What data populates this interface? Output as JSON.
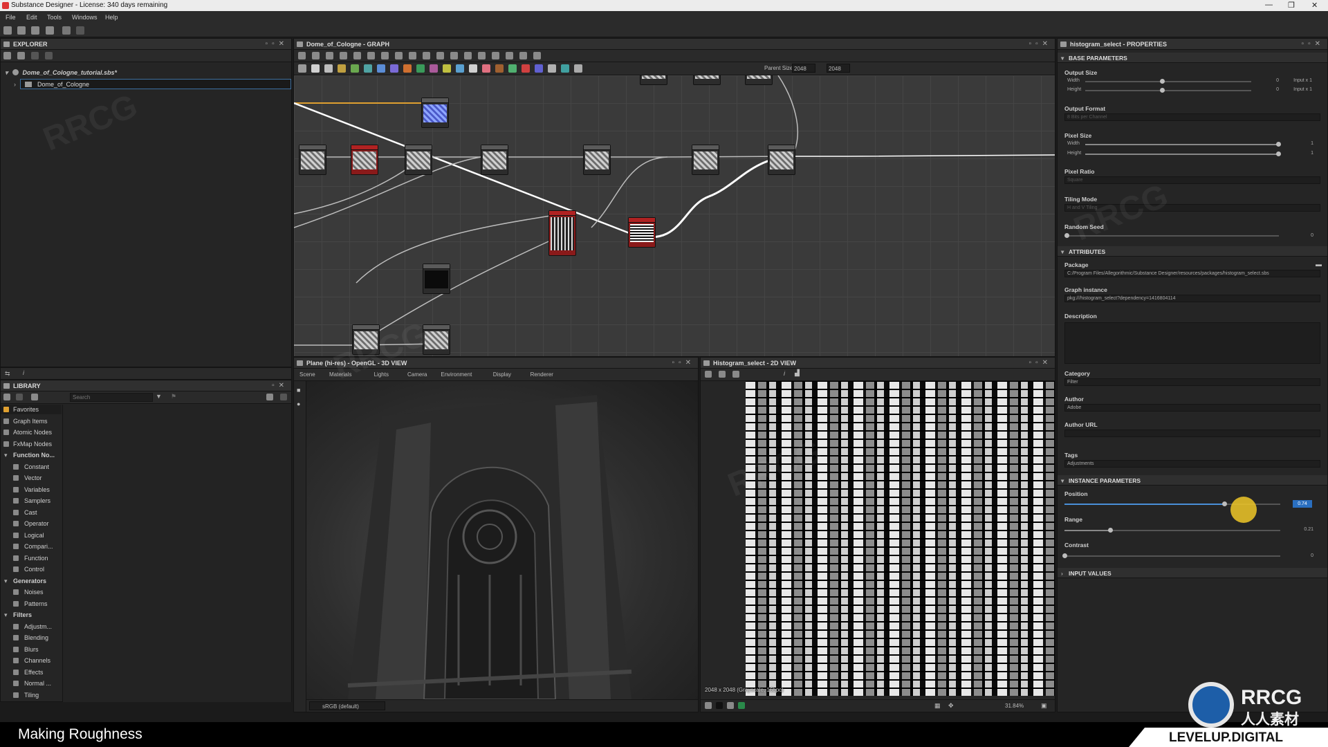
{
  "titlebar": {
    "title": "Substance Designer - License: 340 days remaining"
  },
  "menu": [
    "File",
    "Edit",
    "Tools",
    "Windows",
    "Help"
  ],
  "explorer": {
    "title": "EXPLORER",
    "package": "Dome_of_Cologne_tutorial.sbs*",
    "graph": "Dome_of_Cologne"
  },
  "graph_panel": {
    "title": "Dome_of_Cologne - GRAPH",
    "parent_size_label": "Parent Size:",
    "width_value": "2048",
    "height_value": "2048"
  },
  "library": {
    "title": "LIBRARY",
    "search_placeholder": "Search",
    "items": [
      {
        "label": "Favorites",
        "type": "item"
      },
      {
        "label": "Graph Items",
        "type": "item"
      },
      {
        "label": "Atomic Nodes",
        "type": "item"
      },
      {
        "label": "FxMap Nodes",
        "type": "item"
      },
      {
        "label": "Function No...",
        "type": "group"
      },
      {
        "label": "Constant",
        "type": "sub"
      },
      {
        "label": "Vector",
        "type": "sub"
      },
      {
        "label": "Variables",
        "type": "sub"
      },
      {
        "label": "Samplers",
        "type": "sub"
      },
      {
        "label": "Cast",
        "type": "sub"
      },
      {
        "label": "Operator",
        "type": "sub"
      },
      {
        "label": "Logical",
        "type": "sub"
      },
      {
        "label": "Compari...",
        "type": "sub"
      },
      {
        "label": "Function",
        "type": "sub"
      },
      {
        "label": "Control",
        "type": "sub"
      },
      {
        "label": "Generators",
        "type": "group"
      },
      {
        "label": "Noises",
        "type": "sub"
      },
      {
        "label": "Patterns",
        "type": "sub"
      },
      {
        "label": "Filters",
        "type": "group"
      },
      {
        "label": "Adjustm...",
        "type": "sub"
      },
      {
        "label": "Blending",
        "type": "sub"
      },
      {
        "label": "Blurs",
        "type": "sub"
      },
      {
        "label": "Channels",
        "type": "sub"
      },
      {
        "label": "Effects",
        "type": "sub"
      },
      {
        "label": "Normal ...",
        "type": "sub"
      },
      {
        "label": "Tiling",
        "type": "sub"
      }
    ]
  },
  "view3d": {
    "title": "Plane (hi-res) - OpenGL - 3D VIEW",
    "tabs": [
      "Scene",
      "Materials",
      "Lights",
      "Camera",
      "Environment",
      "Display",
      "Renderer"
    ],
    "colorspace": "sRGB (default)"
  },
  "view2d": {
    "title": "Histogram_select - 2D VIEW",
    "resolution": "2048 x 2048 (Grayscale, 16bpc)",
    "zoom": "31.84%"
  },
  "properties": {
    "title": "histogram_select - PROPERTIES",
    "sections": {
      "base": "BASE PARAMETERS",
      "attributes": "ATTRIBUTES",
      "instance": "INSTANCE PARAMETERS",
      "input": "INPUT VALUES"
    },
    "output_size": {
      "label": "Output Size",
      "width": "Width",
      "height": "Height",
      "wval": "0",
      "hval": "0",
      "wmode": "Input x 1",
      "hmode": "Input x 1"
    },
    "output_format": {
      "label": "Output Format",
      "value": "8 Bits per Channel"
    },
    "pixel_size": {
      "label": "Pixel Size",
      "width": "Width",
      "height": "Height",
      "wval": "1",
      "hval": "1"
    },
    "pixel_ratio": {
      "label": "Pixel Ratio",
      "value": "Square"
    },
    "tiling_mode": {
      "label": "Tiling Mode",
      "value": "H and V Tiling"
    },
    "random_seed": {
      "label": "Random Seed",
      "value": "0"
    },
    "package": {
      "label": "Package",
      "value": "C:/Program Files/Allegorithmic/Substance Designer/resources/packages/histogram_select.sbs"
    },
    "graph_instance": {
      "label": "Graph instance",
      "value": "pkg:///histogram_select?dependency=1416804114"
    },
    "description": {
      "label": "Description"
    },
    "category": {
      "label": "Category",
      "value": "Filter"
    },
    "author": {
      "label": "Author",
      "value": "Adobe"
    },
    "author_url": {
      "label": "Author URL"
    },
    "tags": {
      "label": "Tags",
      "value": "Adjustments"
    },
    "position": {
      "label": "Position",
      "value": "0.74",
      "level": 0.74
    },
    "range": {
      "label": "Range",
      "value": "0.21",
      "level": 0.21
    },
    "contrast": {
      "label": "Contrast",
      "value": "0",
      "level": 0
    }
  },
  "overlay": {
    "caption": "Making Roughness",
    "brand_top": "RRCG",
    "brand_cn": "人人素材",
    "brand_bottom": "LEVELUP.DIGITAL",
    "watermark": "RRCG"
  }
}
